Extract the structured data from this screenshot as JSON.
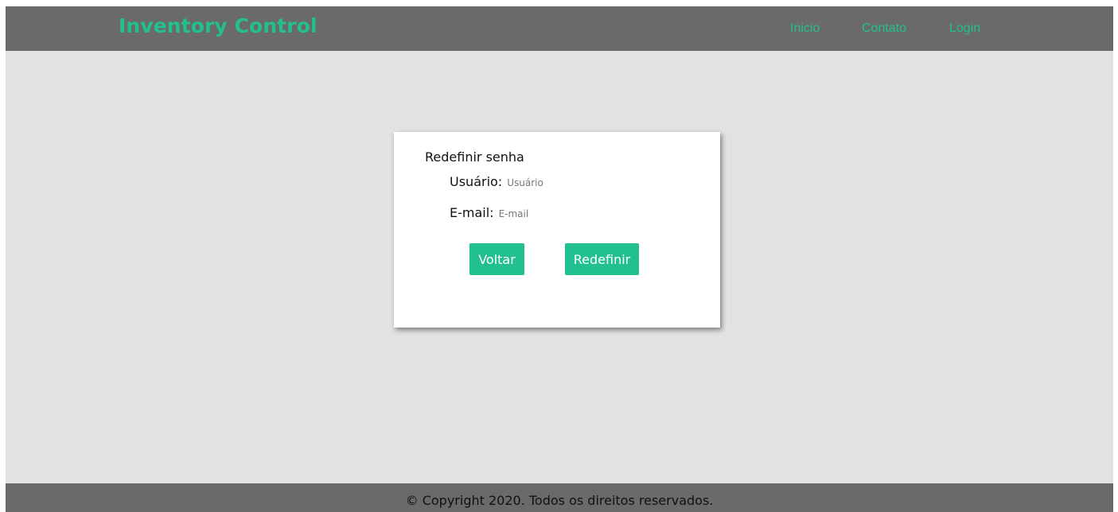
{
  "header": {
    "brand": "Inventory Control",
    "nav": [
      "Inicio",
      "Contato",
      "Login"
    ]
  },
  "form": {
    "title": "Redefinir senha",
    "fields": {
      "user": {
        "label": "Usuário:",
        "placeholder": "Usuário",
        "value": ""
      },
      "email": {
        "label": "E-mail:",
        "placeholder": "E-mail",
        "value": ""
      }
    },
    "buttons": {
      "back": "Voltar",
      "reset": "Redefinir"
    }
  },
  "footer": {
    "text": "© Copyright 2020. Todos os direitos reservados."
  },
  "colors": {
    "accent": "#22c08f",
    "header_bg": "#6a6a6a",
    "page_bg": "#e2e2e2"
  }
}
